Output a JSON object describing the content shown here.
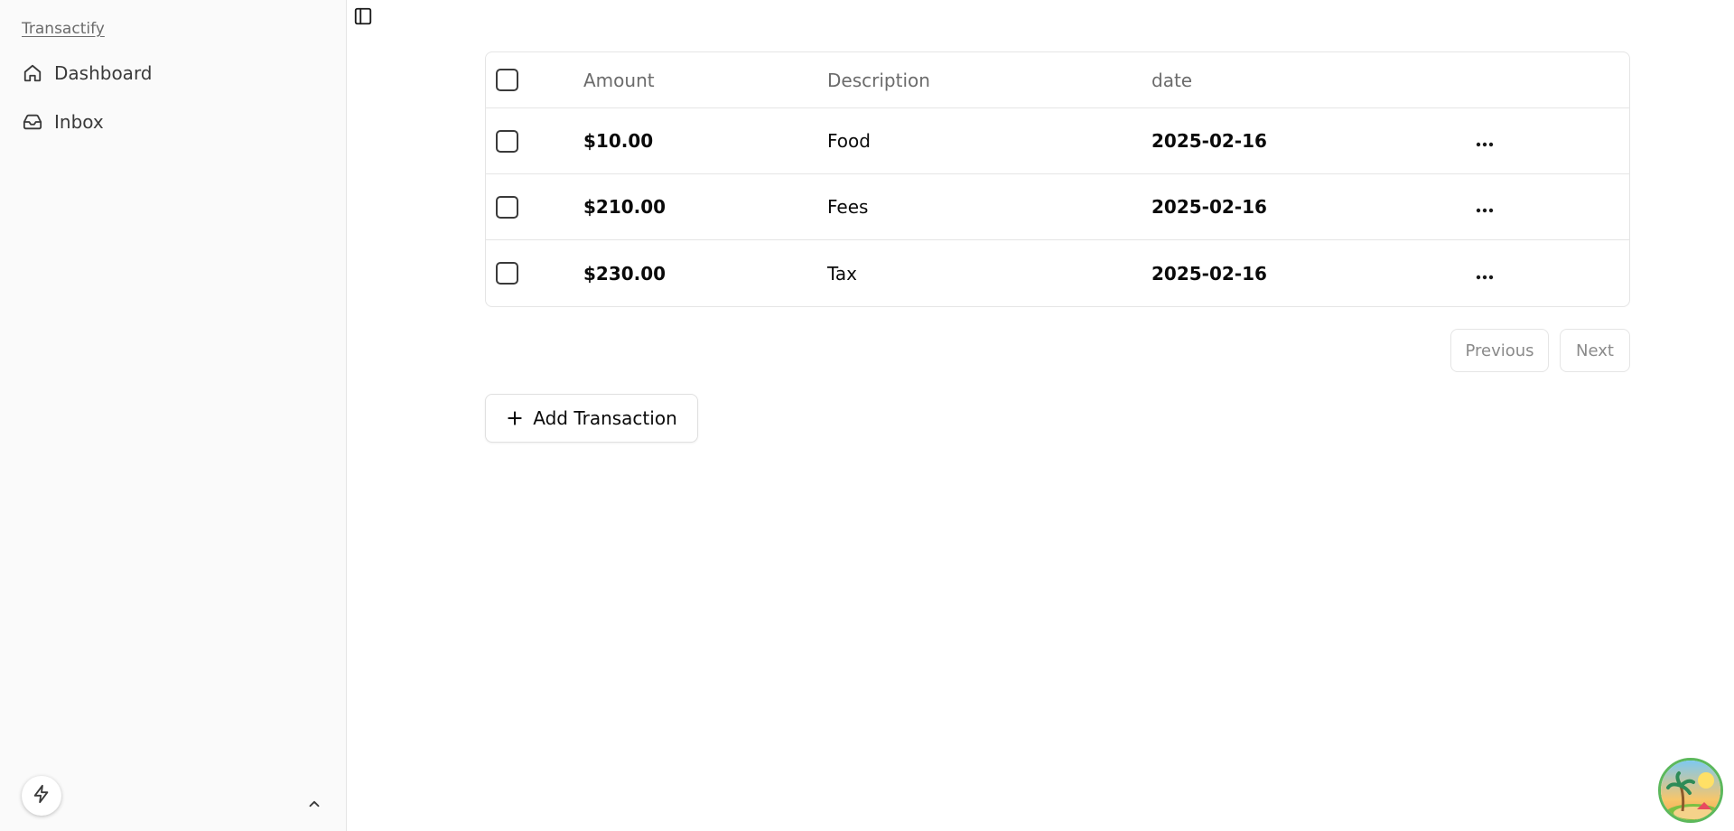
{
  "sidebar": {
    "brand": "Transactify",
    "items": [
      {
        "label": "Dashboard",
        "icon": "home-icon"
      },
      {
        "label": "Inbox",
        "icon": "inbox-icon"
      }
    ]
  },
  "table": {
    "headers": {
      "amount": "Amount",
      "description": "Description",
      "date": "date"
    },
    "rows": [
      {
        "amount": "$10.00",
        "description": "Food",
        "date": "2025-02-16"
      },
      {
        "amount": "$210.00",
        "description": "Fees",
        "date": "2025-02-16"
      },
      {
        "amount": "$230.00",
        "description": "Tax",
        "date": "2025-02-16"
      }
    ]
  },
  "pagination": {
    "previous": "Previous",
    "next": "Next"
  },
  "actions": {
    "add_transaction": "Add Transaction"
  },
  "colors": {
    "sidebar_bg": "#fafafa",
    "border": "#e5e5e5",
    "muted_text": "#6b6b6b"
  }
}
